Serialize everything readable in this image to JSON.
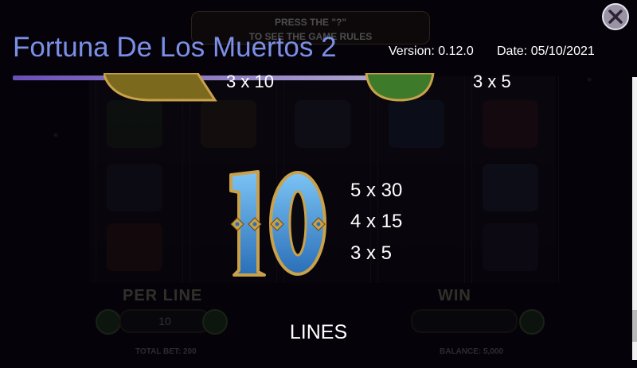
{
  "header": {
    "title": "Fortuna De Los Muertos 2",
    "version": "Version: 0.12.0",
    "date": "Date: 05/10/2021"
  },
  "background": {
    "banner_line1": "PRESS THE \"?\"",
    "banner_line2": "TO SEE THE GAME RULES",
    "per_line_label": "PER LINE",
    "per_line_value": "10",
    "win_label": "WIN",
    "total_bet": "TOTAL BET: 200",
    "balance": "BALANCE: 5,000"
  },
  "paytable": {
    "previous": {
      "left_pay": "3 x 10",
      "right_pay": "3 x 5"
    },
    "current": {
      "symbol": "10",
      "pays": [
        "5 x 30",
        "4 x 15",
        "3 x 5"
      ]
    },
    "next_section": "LINES"
  },
  "colors": {
    "title": "#7b8fe6",
    "accent_bar": "#6a4fb8",
    "symbol_blue": "#3f8fd9",
    "symbol_gold": "#c9a14a"
  },
  "icons": {
    "close": "close-icon"
  }
}
